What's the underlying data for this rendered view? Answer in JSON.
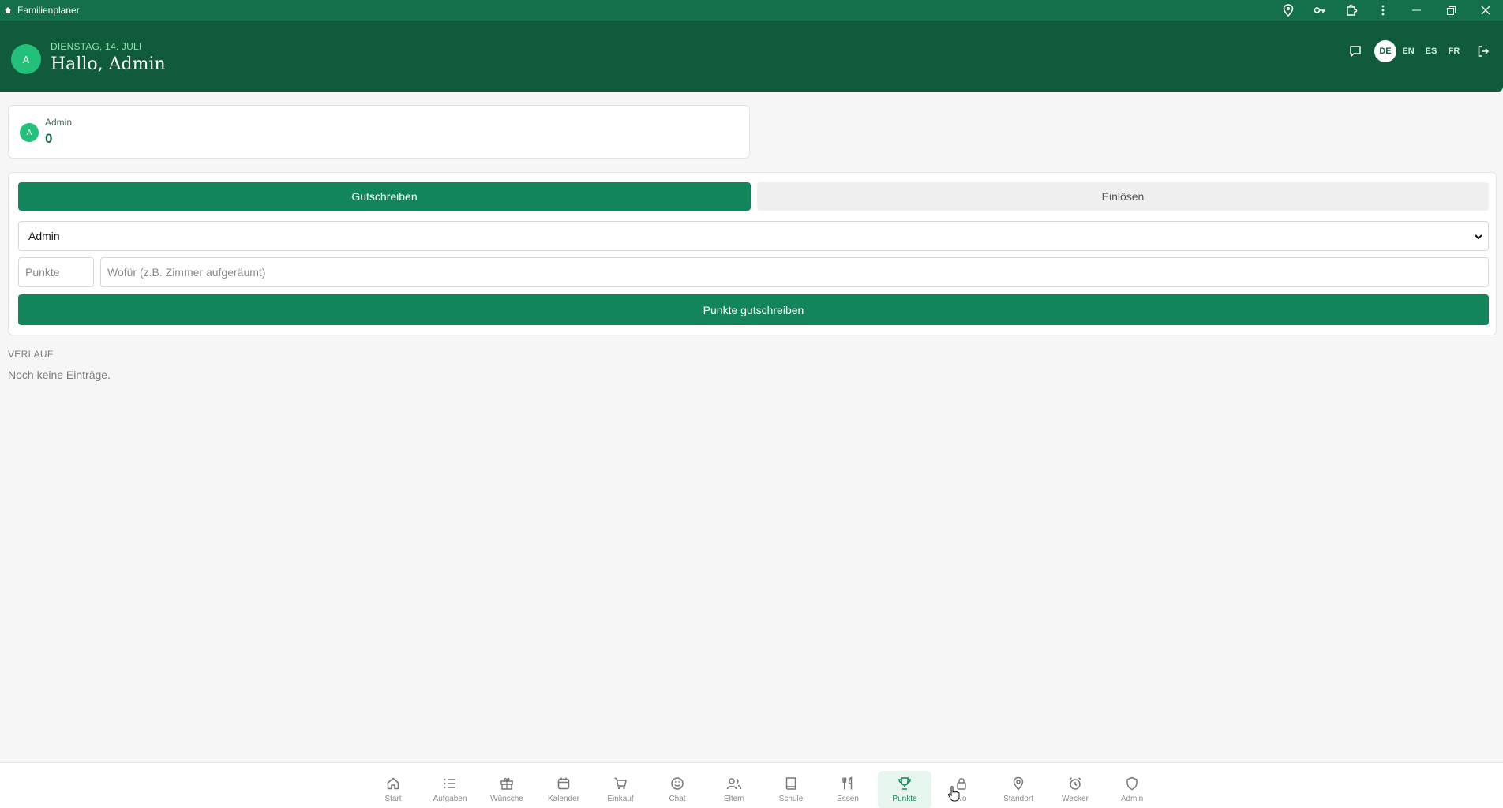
{
  "window": {
    "title": "Familienplaner",
    "toolbar_icons": [
      "location-pin-icon",
      "key-icon",
      "extension-icon",
      "more-vert-icon"
    ],
    "controls": [
      "minimize-icon",
      "restore-icon",
      "close-icon"
    ]
  },
  "header": {
    "avatar_initial": "A",
    "date": "DIENSTAG, 14. JULI",
    "greeting": "Hallo, Admin",
    "languages": [
      "DE",
      "EN",
      "ES",
      "FR"
    ],
    "active_language": "DE"
  },
  "balance": {
    "avatar_initial": "A",
    "name": "Admin",
    "points": "0"
  },
  "form": {
    "tab_credit": "Gutschreiben",
    "tab_redeem": "Einlösen",
    "active_tab": "Gutschreiben",
    "member_selected": "Admin",
    "points_placeholder": "Punkte",
    "reason_placeholder": "Wofür (z.B. Zimmer aufgeräumt)",
    "submit_label": "Punkte gutschreiben"
  },
  "history": {
    "title": "VERLAUF",
    "empty_text": "Noch keine Einträge."
  },
  "nav": {
    "items": [
      {
        "label": "Start",
        "icon": "home-icon"
      },
      {
        "label": "Aufgaben",
        "icon": "list-icon"
      },
      {
        "label": "Wünsche",
        "icon": "gift-icon"
      },
      {
        "label": "Kalender",
        "icon": "calendar-icon"
      },
      {
        "label": "Einkauf",
        "icon": "cart-icon"
      },
      {
        "label": "Chat",
        "icon": "smiley-icon"
      },
      {
        "label": "Eltern",
        "icon": "users-icon"
      },
      {
        "label": "Schule",
        "icon": "book-icon"
      },
      {
        "label": "Essen",
        "icon": "cutlery-icon"
      },
      {
        "label": "Punkte",
        "icon": "trophy-icon"
      },
      {
        "label": "No",
        "icon": "lock-icon"
      },
      {
        "label": "Standort",
        "icon": "map-pin-icon"
      },
      {
        "label": "Wecker",
        "icon": "alarm-icon"
      },
      {
        "label": "Admin",
        "icon": "shield-icon"
      }
    ],
    "active": "Punkte"
  },
  "colors": {
    "titlebar": "#14704b",
    "header": "#0f5b3b",
    "accent": "#13855a",
    "avatar": "#23c07a"
  }
}
